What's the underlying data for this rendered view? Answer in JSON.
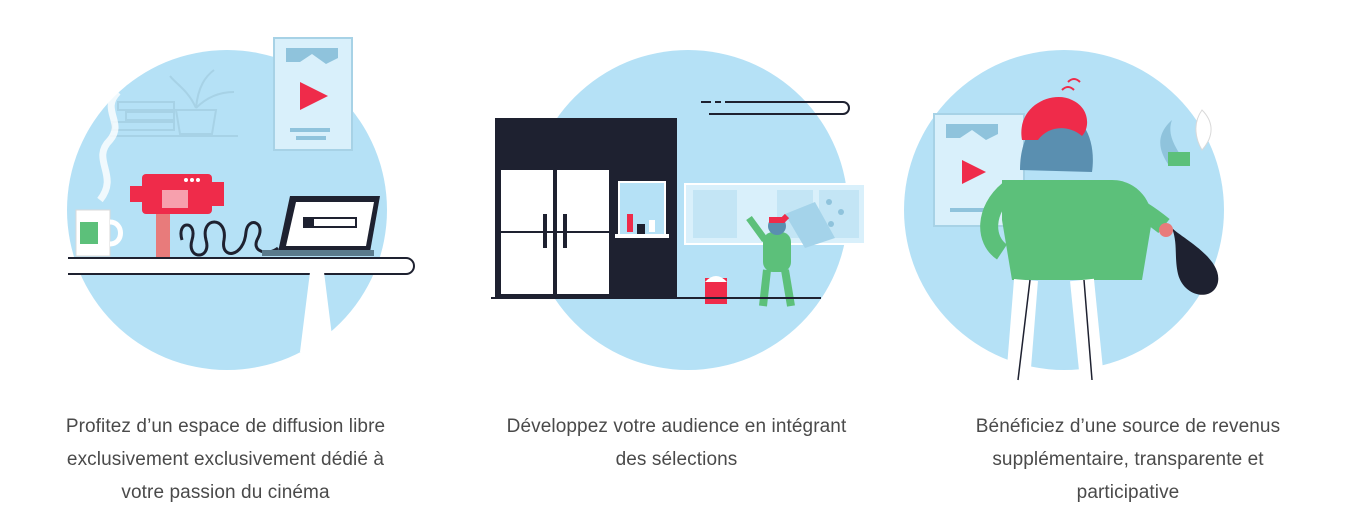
{
  "features": [
    {
      "illustration": "laptop-and-camera-illustration",
      "caption_lines": [
        "Profitez d’un espace de diffusion libre",
        "exclusivement exclusivement dédié à",
        "votre passion du cinéma"
      ]
    },
    {
      "illustration": "cinema-building-illustration",
      "caption_lines": [
        "Développez votre audience en intégrant",
        "des sélections"
      ]
    },
    {
      "illustration": "person-receiving-revenue-illustration",
      "caption_lines": [
        "Bénéficiez d’une source de revenus",
        "supplémentaire, transparente et",
        "participative"
      ]
    }
  ],
  "colors": {
    "circle": "#b5e1f6",
    "accent_red": "#ef2b4a",
    "accent_green": "#5cc07a",
    "dark": "#1e2130",
    "text": "#4a4a4a"
  }
}
